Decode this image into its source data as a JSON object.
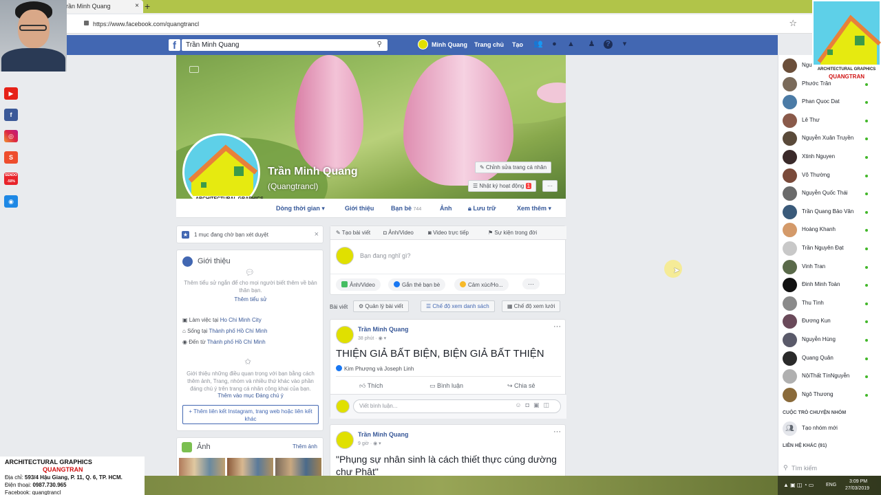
{
  "browser": {
    "tab_title": "rần Minh Quang",
    "tab_close": "×",
    "new_tab": "+",
    "url": "https://www.facebook.com/quangtrancl"
  },
  "fb_header": {
    "logo": "f",
    "search_value": "Trần Minh Quang",
    "user_name": "Minh Quang",
    "home": "Trang chủ",
    "create": "Tạo"
  },
  "profile": {
    "name": "Trần Minh Quang",
    "username": "(Quangtrancl)",
    "edit_button": "Chỉnh sửa trang cá nhân",
    "activity_log": "Nhật ký hoạt động",
    "activity_badge": "1",
    "more": "···"
  },
  "profile_tabs": [
    {
      "label": "Dòng thời gian ▾"
    },
    {
      "label": "Giới thiệu"
    },
    {
      "label": "Bạn bè",
      "count": "744"
    },
    {
      "label": "Ảnh"
    },
    {
      "label": "Lưu trữ"
    },
    {
      "label": "Xem thêm ▾"
    }
  ],
  "pending": {
    "text": "1 mục đang chờ bạn xét duyệt",
    "close": "×"
  },
  "intro": {
    "title": "Giới thiệu",
    "bio_hint": "Thêm tiểu sử ngắn để cho mọi người biết thêm về bản thân bạn.",
    "bio_link": "Thêm tiểu sử",
    "work_prefix": "Làm việc tại",
    "work_place": "Ho Chi Minh City",
    "live_prefix": "Sống tại",
    "live_place": "Thành phố Hồ Chí Minh",
    "from_prefix": "Đến từ",
    "from_place": "Thành phố Hồ Chí Minh",
    "featured_hint": "Giới thiệu những điều quan trọng với bạn bằng cách thêm ảnh, Trang, nhóm và nhiều thứ khác vào phần đáng chú ý trên trang cá nhân công khai của bạn.",
    "featured_link": "Thêm vào mục Đáng chú ý",
    "add_links": "+ Thêm liên kết Instagram, trang web hoặc liên kết khác"
  },
  "photos": {
    "title": "Ảnh",
    "add_link": "Thêm ảnh"
  },
  "composer": {
    "actions": [
      "Tạo bài viết",
      "Ảnh/Video",
      "Video trực tiếp",
      "Sự kiện trong đời"
    ],
    "placeholder": "Bạn đang nghĩ gì?",
    "buttons": [
      "Ảnh/Video",
      "Gắn thẻ bạn bè",
      "Cảm xúc/Ho..."
    ],
    "more": "···"
  },
  "posts_bar": {
    "label": "Bài viết",
    "manage": "Quản lý bài viết",
    "list_view": "Chế độ xem danh sách",
    "grid_view": "Chế độ xem lưới"
  },
  "posts": [
    {
      "author": "Trần Minh Quang",
      "time": "38 phút · ◉ ▾",
      "text": "THIỆN GIẢ BẤT BIỆN, BIỆN GIẢ BẤT THIỆN",
      "reactions": "Kim Phượng và Joseph Linh",
      "like": "Thích",
      "comment": "Bình luận",
      "share": "Chia sẻ",
      "comment_placeholder": "Viết bình luận...",
      "more": "···"
    },
    {
      "author": "Trần Minh Quang",
      "time": "9 giờ · ◉ ▾",
      "text": "\"Phụng sự nhân sinh là cách thiết thực cúng dường chư Phật\"",
      "more": "···"
    }
  ],
  "contacts": [
    {
      "name": "Nguyễn Quang",
      "color": "#6b4f3a"
    },
    {
      "name": "Phước Trần",
      "color": "#7a6a5a"
    },
    {
      "name": "Phan Quoc Dat",
      "color": "#4b7ba6"
    },
    {
      "name": "Lê Thư",
      "color": "#8a5a4a"
    },
    {
      "name": "Nguyễn Xuân Truyền",
      "color": "#5a4a3a"
    },
    {
      "name": "Xtinh Nguyen",
      "color": "#3a2a2a"
    },
    {
      "name": "Võ Thường",
      "color": "#7a4a3a"
    },
    {
      "name": "Nguyễn Quốc Thái",
      "color": "#6a6a6a"
    },
    {
      "name": "Trần Quang Bảo Vân",
      "color": "#3a5a7a"
    },
    {
      "name": "Hoàng Khanh",
      "color": "#d49a6a"
    },
    {
      "name": "Trần Nguyên Đạt",
      "color": "#c8c8c8"
    },
    {
      "name": "Vinh Tran",
      "color": "#5a6a4a"
    },
    {
      "name": "Đinh Minh Toàn",
      "color": "#111111"
    },
    {
      "name": "Thu Tình",
      "color": "#8a8a8a"
    },
    {
      "name": "Đương Kun",
      "color": "#6a4a5a"
    },
    {
      "name": "Nguyễn Hùng",
      "color": "#5a5a6a"
    },
    {
      "name": "Quang Quân",
      "color": "#2a2a2a"
    },
    {
      "name": "NộiThất TínNguyễn",
      "color": "#b0b0b0"
    },
    {
      "name": "Ngô Thương",
      "color": "#8a6a3a"
    }
  ],
  "group_chats": {
    "header": "CUỘC TRÒ CHUYỆN NHÓM",
    "create": "Tạo nhóm mới"
  },
  "other_contacts": {
    "header": "LIÊN HỆ KHÁC (91)"
  },
  "chat_search": "Tìm kiếm",
  "taskbar": {
    "lang": "ENG",
    "time": "3:09 PM",
    "date": "27/03/2019"
  },
  "brand": {
    "line1": "ARCHITECTURAL GRAPHICS",
    "line2": "QUANGTRAN"
  },
  "watermark": {
    "line1": "ARCHITECTURAL GRAPHICS",
    "line2": "QUANGTRAN",
    "address_label": "Địa chỉ:",
    "address": "593/4 Hậu Giang, P. 11, Q. 6, TP. HCM.",
    "phone_label": "Điện thoại:",
    "phone": "0987.730.965",
    "facebook": "Facebook: quangtrancl"
  },
  "social_icons": [
    "youtube-icon",
    "facebook-icon",
    "instagram-icon",
    "shopee-icon",
    "sendo-icon",
    "zalo-icon"
  ],
  "sendo_label": "SENDO -50%",
  "colors": {
    "fb_blue": "#4267b2",
    "link": "#385898",
    "online": "#42b72a",
    "brand_yellow": "#e0e000",
    "brand_orange": "#e8803a",
    "brand_red": "#d01010"
  }
}
